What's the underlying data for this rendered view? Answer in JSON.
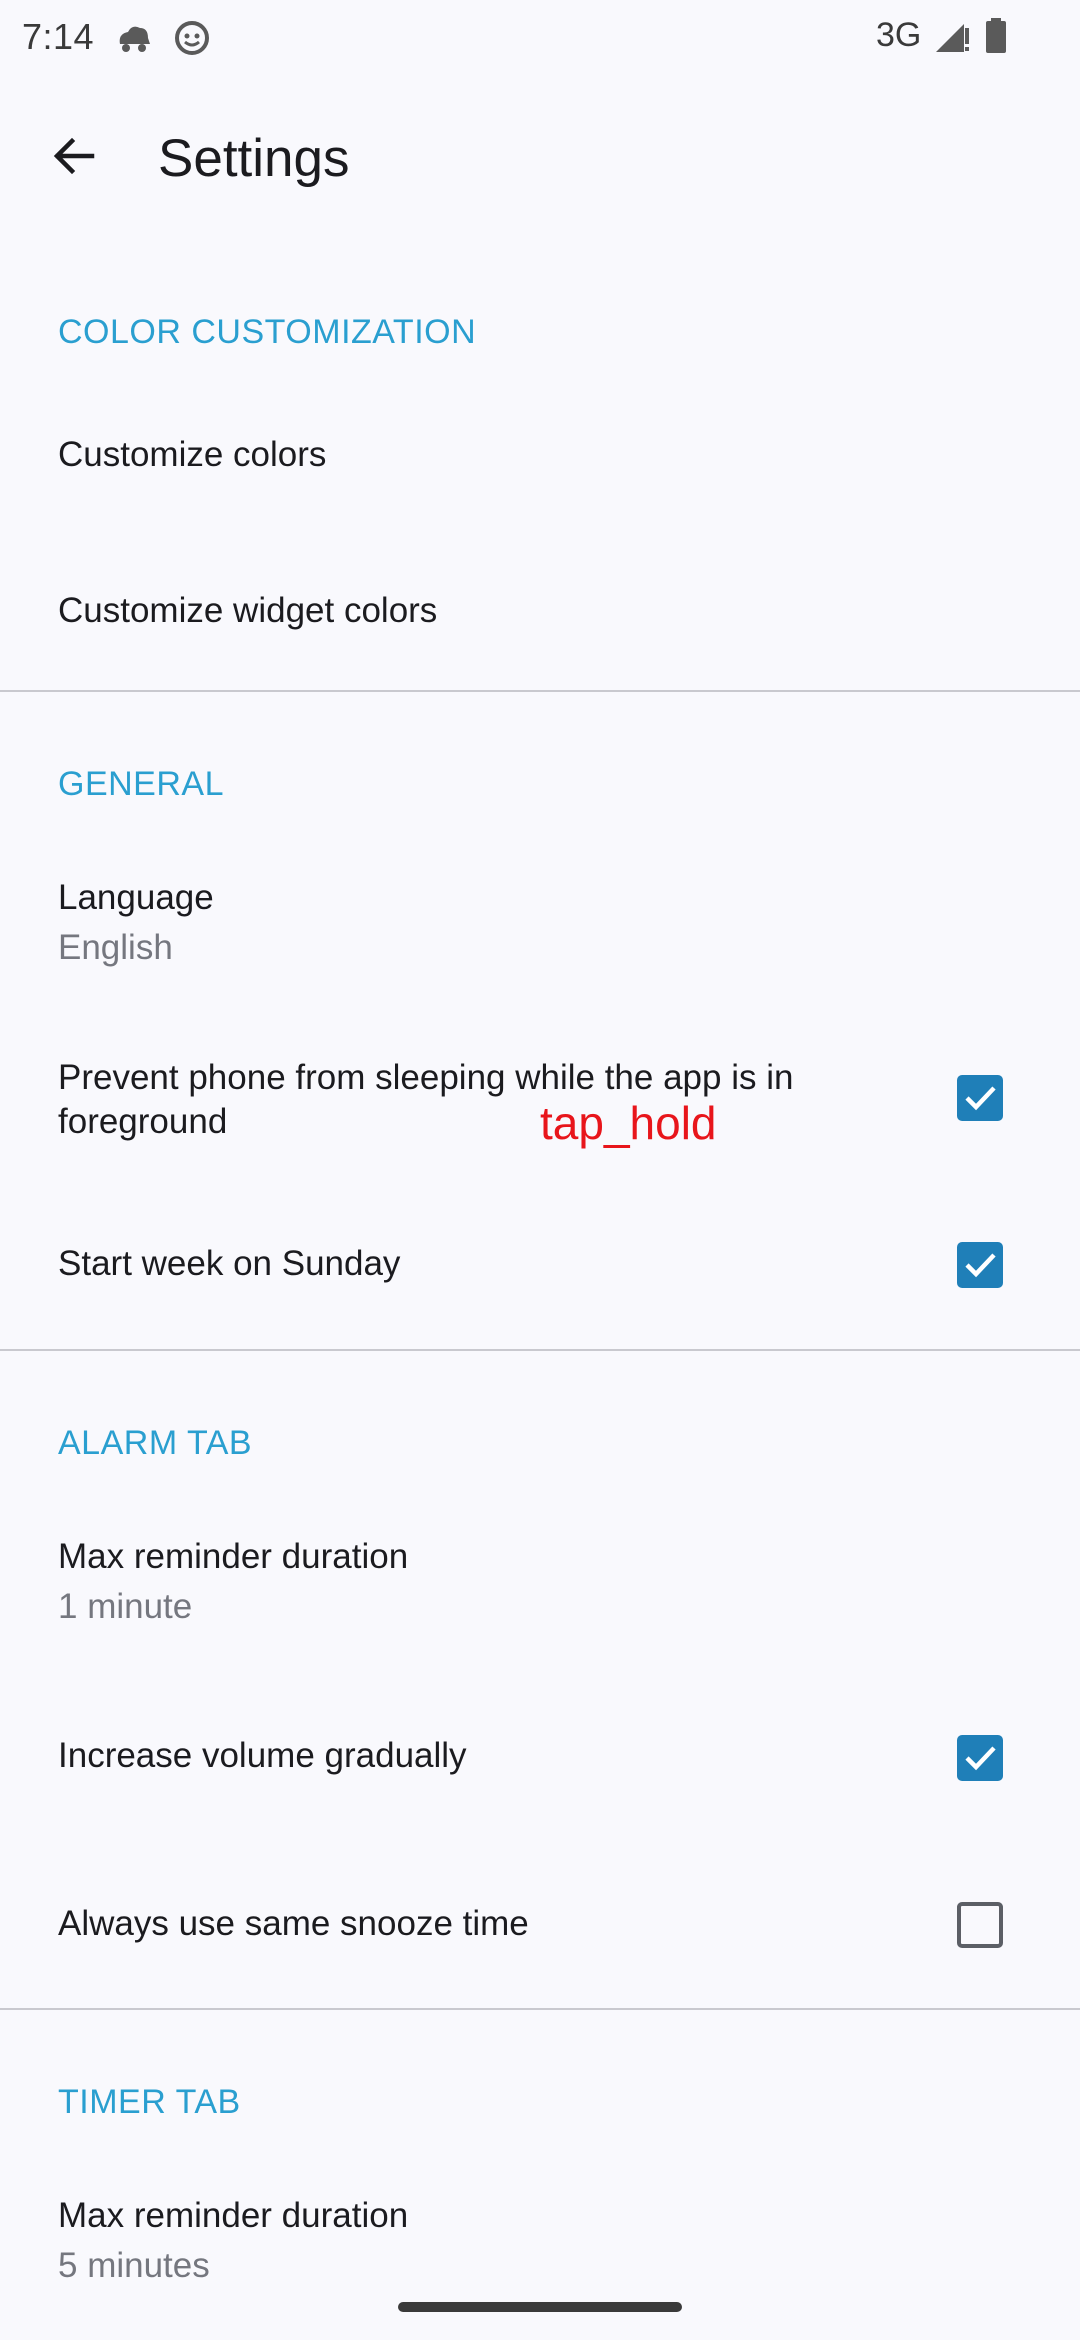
{
  "status_bar": {
    "time": "7:14",
    "network": "3G",
    "icons": [
      "cloud-car-icon",
      "android-face-icon",
      "signal-icon",
      "battery-icon"
    ]
  },
  "app_bar": {
    "title": "Settings",
    "back_icon": "arrow-back-icon"
  },
  "sections": {
    "color_customization": {
      "header": "COLOR CUSTOMIZATION",
      "items": [
        {
          "title": "Customize colors"
        },
        {
          "title": "Customize widget colors"
        }
      ]
    },
    "general": {
      "header": "GENERAL",
      "language": {
        "title": "Language",
        "summary": "English"
      },
      "prevent_sleep": {
        "title_line1": "Prevent phone from sleeping while the app is in",
        "title_line2": "foreground",
        "checked": true
      },
      "start_week": {
        "title": "Start week on Sunday",
        "checked": true
      }
    },
    "alarm_tab": {
      "header": "ALARM TAB",
      "max_reminder": {
        "title": "Max reminder duration",
        "summary": "1 minute"
      },
      "increase_volume": {
        "title": "Increase volume gradually",
        "checked": true
      },
      "same_snooze": {
        "title": "Always use same snooze time",
        "checked": false
      }
    },
    "timer_tab": {
      "header": "TIMER TAB",
      "max_reminder": {
        "title": "Max reminder duration",
        "summary": "5 minutes"
      }
    }
  },
  "annotation": "tap_hold",
  "colors": {
    "accent": "#2a9fd0",
    "checkbox": "#1f7fb8",
    "background": "#f9f9fd",
    "annotation": "#e8151b"
  }
}
